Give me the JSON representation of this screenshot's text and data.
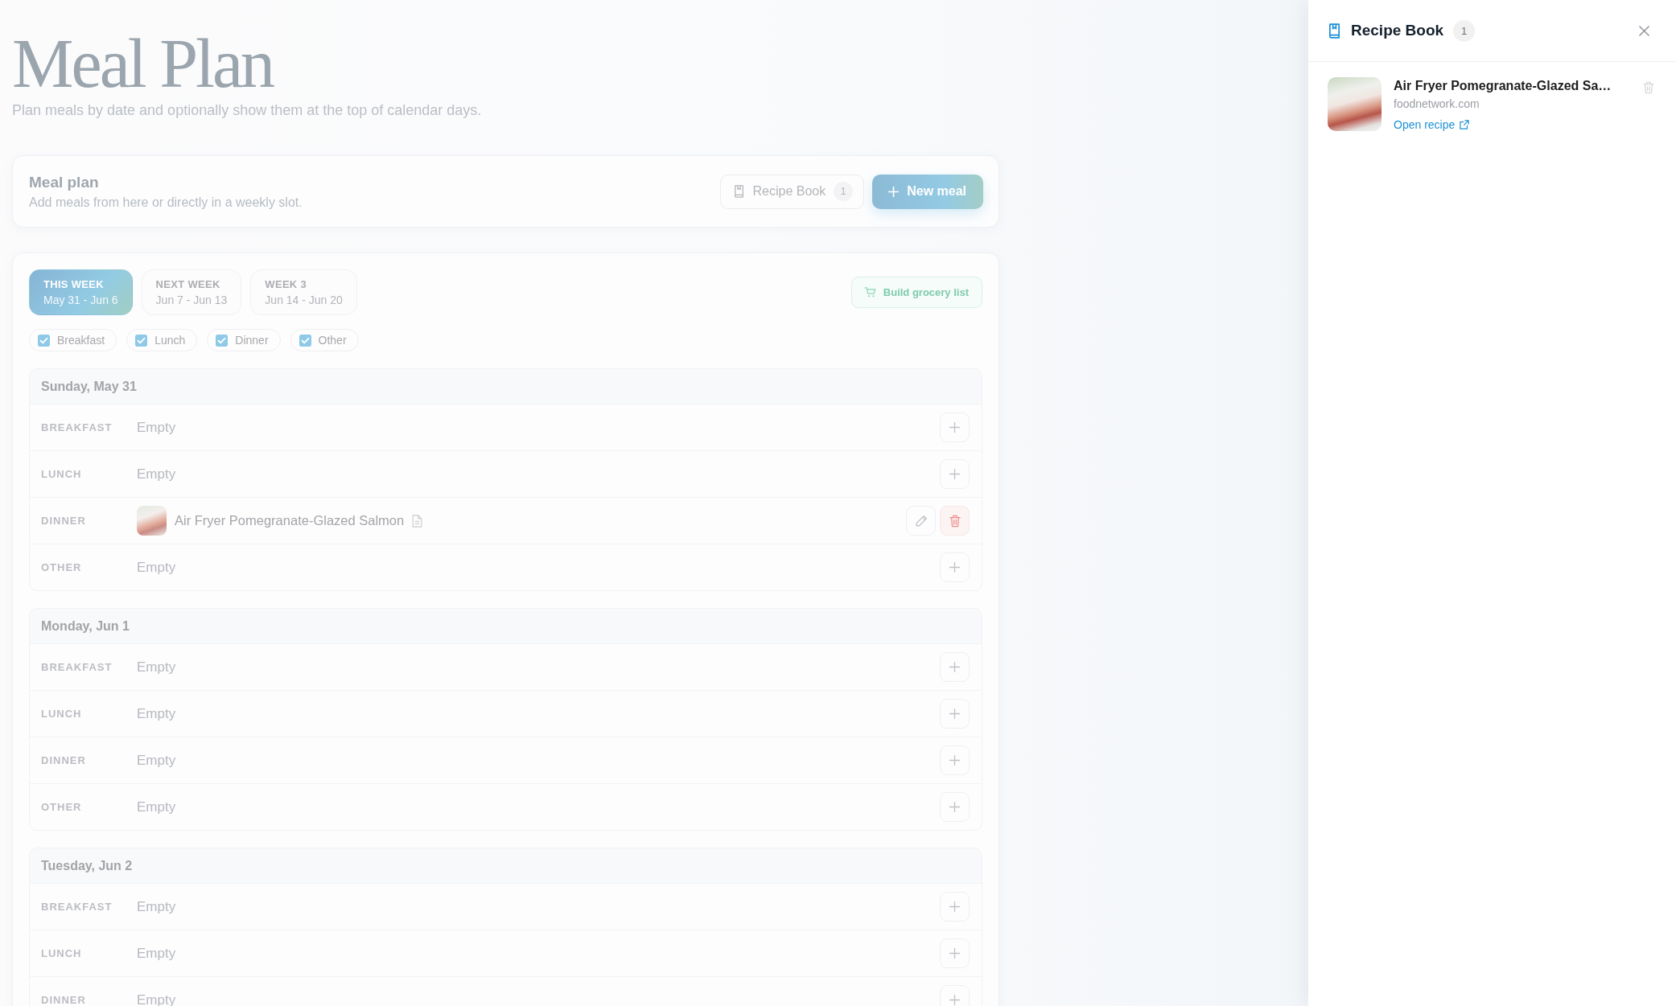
{
  "page": {
    "title": "Meal Plan",
    "subtitle": "Plan meals by date and optionally show them at the top of calendar days."
  },
  "meal_plan_card": {
    "title": "Meal plan",
    "subtitle": "Add meals from here or directly in a weekly slot.",
    "recipe_book_button": {
      "label": "Recipe Book",
      "count": "1"
    },
    "new_meal_button": {
      "label": "New meal"
    }
  },
  "week_tabs": [
    {
      "label": "THIS WEEK",
      "dates": "May 31 - Jun 6",
      "selected": true
    },
    {
      "label": "NEXT WEEK",
      "dates": "Jun 7 - Jun 13",
      "selected": false
    },
    {
      "label": "WEEK 3",
      "dates": "Jun 14 - Jun 20",
      "selected": false
    }
  ],
  "grocery_button": {
    "label": "Build grocery list"
  },
  "meal_filters": [
    {
      "label": "Breakfast",
      "checked": true
    },
    {
      "label": "Lunch",
      "checked": true
    },
    {
      "label": "Dinner",
      "checked": true
    },
    {
      "label": "Other",
      "checked": true
    }
  ],
  "days": [
    {
      "date": "Sunday, May 31",
      "slots": [
        {
          "kind": "empty",
          "meal": "BREAKFAST",
          "text": "Empty"
        },
        {
          "kind": "empty",
          "meal": "LUNCH",
          "text": "Empty"
        },
        {
          "kind": "recipe",
          "meal": "DINNER",
          "text": "Air Fryer Pomegranate-Glazed Salmon"
        },
        {
          "kind": "empty",
          "meal": "OTHER",
          "text": "Empty"
        }
      ]
    },
    {
      "date": "Monday, Jun 1",
      "slots": [
        {
          "kind": "empty",
          "meal": "BREAKFAST",
          "text": "Empty"
        },
        {
          "kind": "empty",
          "meal": "LUNCH",
          "text": "Empty"
        },
        {
          "kind": "empty",
          "meal": "DINNER",
          "text": "Empty"
        },
        {
          "kind": "empty",
          "meal": "OTHER",
          "text": "Empty"
        }
      ]
    },
    {
      "date": "Tuesday, Jun 2",
      "slots": [
        {
          "kind": "empty",
          "meal": "BREAKFAST",
          "text": "Empty"
        },
        {
          "kind": "empty",
          "meal": "LUNCH",
          "text": "Empty"
        },
        {
          "kind": "empty",
          "meal": "DINNER",
          "text": "Empty"
        }
      ]
    }
  ],
  "recipe_drawer": {
    "title": "Recipe Book",
    "count": "1",
    "recipes": [
      {
        "title": "Air Fryer Pomegranate-Glazed Sa…",
        "source": "foodnetwork.com",
        "link": "Open recipe"
      }
    ]
  }
}
